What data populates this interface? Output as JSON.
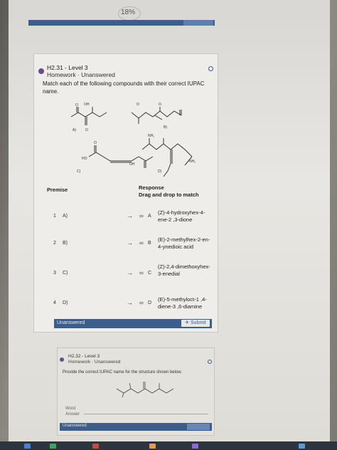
{
  "header": {
    "progress_text": "18%"
  },
  "question1": {
    "title": "H2.31 - Level 3",
    "subtitle": "Homework · Unanswered",
    "prompt": "Match each of the following compounds with their correct IUPAC name.",
    "structure_labels": {
      "A": "A)",
      "B": "B)",
      "C": "C)",
      "D": "D)",
      "OH": "OH",
      "O": "O",
      "NH2": "NH₂",
      "HO": "HO"
    },
    "premise_header": "Premise",
    "response_header": "Response",
    "response_instruction": "Drag and drop to match",
    "rows": [
      {
        "num": "1",
        "premise": "A)",
        "letter": "A",
        "name": "(Z)-4-hydroxyhex-4-ene-2 ,3-dione"
      },
      {
        "num": "2",
        "premise": "B)",
        "letter": "B",
        "name": "(E)-2-methylhex-2-en-4-ynedioic acid"
      },
      {
        "num": "3",
        "premise": "C)",
        "letter": "C",
        "name": "(Z)-2,4-dimethoxyhex-3-enedial"
      },
      {
        "num": "4",
        "premise": "D)",
        "letter": "D",
        "name": "(E)-5-methyloct-1 ,4-diene-3 ,6-diamine"
      }
    ],
    "status": "Unanswered",
    "submit_label": "Submit"
  },
  "question2": {
    "title": "H2.32 - Level 3",
    "subtitle": "Homework · Unanswered",
    "prompt": "Provide the correct IUPAC name for the structure shown below.",
    "word_label": "Word",
    "answer_label": "Answer",
    "status": "Unanswered"
  }
}
